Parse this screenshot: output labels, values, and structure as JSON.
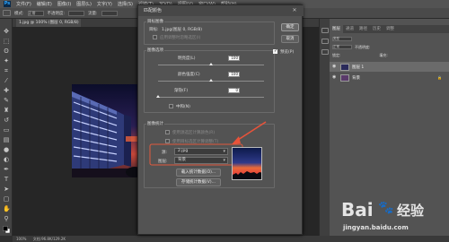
{
  "menu": {
    "items": [
      "文件(F)",
      "编辑(E)",
      "图像(I)",
      "图层(L)",
      "文字(Y)",
      "选择(S)",
      "滤镜(T)",
      "3D(D)",
      "视图(V)",
      "窗口(W)",
      "帮助(H)"
    ]
  },
  "options_bar": {
    "mode_label": "模式:",
    "mode_value": "正常",
    "opacity_label": "不透明度:",
    "flow_label": "流量:"
  },
  "document": {
    "tab_label": "1.jpg @ 100% (图层 0, RGB/8)"
  },
  "status": {
    "zoom": "100%",
    "info": "文档:96.8K/129.2K"
  },
  "panels": {
    "tabs": [
      "图层",
      "通道",
      "路径",
      "历史",
      "调整"
    ],
    "active_tab": "图层",
    "filter_label": "类型",
    "blend_mode": "正常",
    "opacity_label": "不透明度:",
    "lock_label": "锁定:",
    "fill_label": "填充:",
    "layers": [
      {
        "name": "图层 1",
        "active": true
      },
      {
        "name": "背景",
        "active": false,
        "lock": "🔒"
      }
    ]
  },
  "dialog": {
    "title": "匹配颜色",
    "target_group": {
      "title": "目标图像",
      "target_label": "目标:",
      "target_value": "1.jpg(图层 0, RGB/8)",
      "ignore_selection": "应用调整时忽略选区(I)"
    },
    "options_group": {
      "title": "图像选项",
      "luminance_label": "明亮度(L)",
      "luminance_value": "100",
      "luminance_level": 0.5,
      "intensity_label": "颜色强度(C)",
      "intensity_value": "100",
      "intensity_level": 0.5,
      "fade_label": "渐隐(F)",
      "fade_value": "0",
      "fade_level": 0,
      "neutralize_label": "中和(N)"
    },
    "stats_group": {
      "title": "图像统计",
      "use_source_sel": "使用源选区计算颜色(R)",
      "use_target_sel": "使用目标选区计算调整(T)",
      "source_label": "源:",
      "source_value": "2.jpg",
      "layer_label": "图层:",
      "layer_value": "背景",
      "load_btn": "载入统计数据(O)...",
      "save_btn": "存储统计数据(V)..."
    },
    "ok_label": "确定",
    "cancel_label": "取消",
    "preview_label": "预览(P)",
    "preview_checked": true
  },
  "watermark": {
    "brand": "Bai",
    "brand2": "经验",
    "url": "jingyan.baidu.com"
  },
  "colors": {
    "arrow": "#e8533a",
    "highlight": "#e25a3e",
    "dialog_bg": "#535353"
  }
}
